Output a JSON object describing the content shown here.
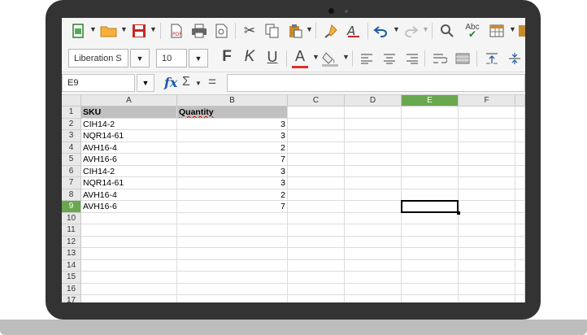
{
  "toolbar": {
    "font_name": "Liberation S",
    "font_size": "10",
    "bold_label": "F",
    "italic_label": "K",
    "underline_label": "U",
    "font_color_label": "A",
    "spellcheck_label": "Abc",
    "accent_colors": {
      "font_color_bar": "#e03030",
      "active_header": "#6aa84f"
    }
  },
  "formula_bar": {
    "name_box": "E9",
    "fx_label": "fx",
    "sum_label": "Σ",
    "equals_label": "=",
    "formula": ""
  },
  "sheet": {
    "columns": [
      "A",
      "B",
      "C",
      "D",
      "E",
      "F"
    ],
    "rows": [
      "1",
      "2",
      "3",
      "4",
      "5",
      "6",
      "7",
      "8",
      "9",
      "10",
      "11",
      "12",
      "13",
      "14",
      "15",
      "16",
      "17"
    ],
    "header": {
      "sku": "SKU",
      "quantity": "Quantity"
    },
    "data": [
      {
        "sku": "CIH14-2",
        "qty": "3"
      },
      {
        "sku": "NQR14-61",
        "qty": "3"
      },
      {
        "sku": "AVH16-4",
        "qty": "2"
      },
      {
        "sku": "AVH16-6",
        "qty": "7"
      },
      {
        "sku": "CIH14-2",
        "qty": "3"
      },
      {
        "sku": "NQR14-61",
        "qty": "3"
      },
      {
        "sku": "AVH16-4",
        "qty": "2"
      },
      {
        "sku": "AVH16-6",
        "qty": "7"
      }
    ],
    "active_cell": "E9"
  }
}
